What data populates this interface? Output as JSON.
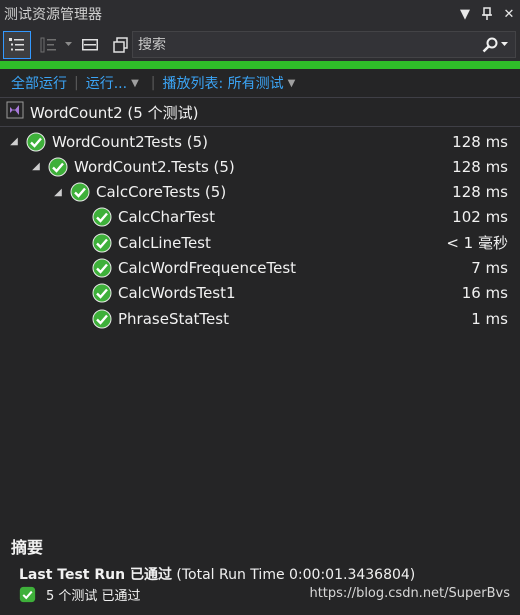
{
  "window": {
    "title": "测试资源管理器",
    "dropdown_glyph": "▼",
    "pin_glyph": "⊥",
    "close_glyph": "✕"
  },
  "search": {
    "placeholder": "搜索"
  },
  "actions": {
    "run_all": "全部运行",
    "run": "运行...",
    "playlist": "播放列表: 所有测试"
  },
  "project": {
    "label": "WordCount2 (5 个测试)"
  },
  "tree": [
    {
      "name": "WordCount2Tests (5)",
      "duration": "128 ms",
      "level": 0,
      "expandable": true
    },
    {
      "name": "WordCount2.Tests (5)",
      "duration": "128 ms",
      "level": 1,
      "expandable": true
    },
    {
      "name": "CalcCoreTests (5)",
      "duration": "128 ms",
      "level": 2,
      "expandable": true
    },
    {
      "name": "CalcCharTest",
      "duration": "102 ms",
      "level": 3,
      "expandable": false
    },
    {
      "name": "CalcLineTest",
      "duration": "< 1 毫秒",
      "level": 3,
      "expandable": false
    },
    {
      "name": "CalcWordFrequenceTest",
      "duration": "7 ms",
      "level": 3,
      "expandable": false
    },
    {
      "name": "CalcWordsTest1",
      "duration": "16 ms",
      "level": 3,
      "expandable": false
    },
    {
      "name": "PhraseStatTest",
      "duration": "1 ms",
      "level": 3,
      "expandable": false
    }
  ],
  "summary": {
    "heading": "摘要",
    "run_bold": "Last Test Run 已通过",
    "run_detail": " (Total Run Time 0:00:01.3436804)",
    "passed": "5 个测试 已通过",
    "watermark": "https://blog.csdn.net/SuperBvs"
  },
  "colors": {
    "pass": "#3eb03a",
    "progress": "#2fbe29",
    "link": "#3ba4f5"
  },
  "icons": [
    "group-by-icon",
    "sort-icon",
    "playlist-icon",
    "copy-icon",
    "search-icon",
    "pass-icon",
    "vs-project-icon"
  ]
}
